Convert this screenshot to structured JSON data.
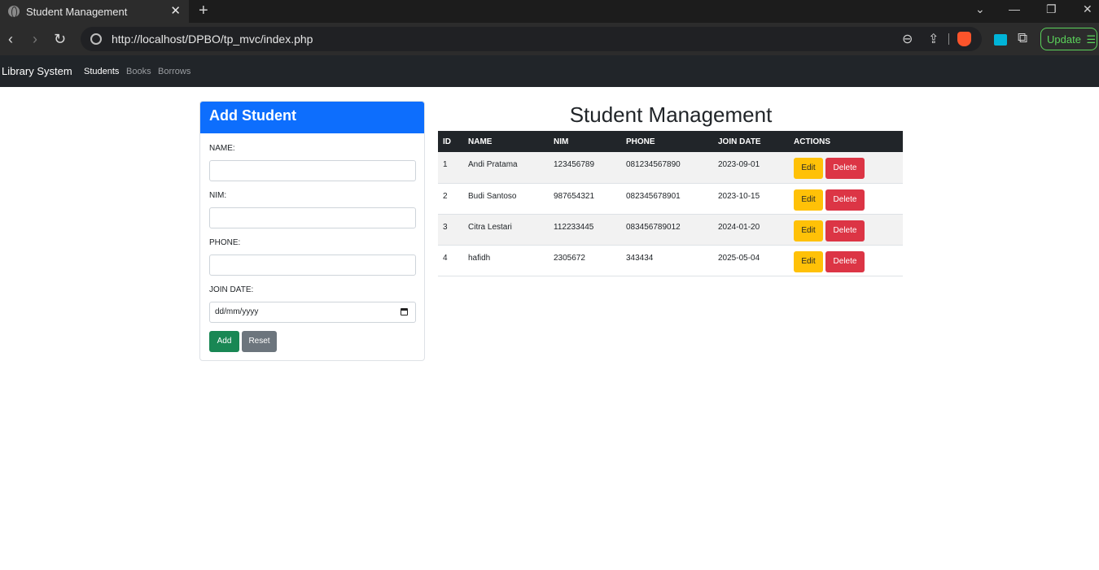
{
  "browser": {
    "tab_title": "Student Management",
    "url": "http://localhost/DPBO/tp_mvc/index.php",
    "update_label": "Update",
    "colors": {
      "accent_update": "#5bd35b",
      "brave": "#fb542b"
    }
  },
  "navbar": {
    "brand": "Library System",
    "links": [
      "Students",
      "Books",
      "Borrows"
    ],
    "active_link": "Students"
  },
  "form": {
    "title": "Add Student",
    "fields": {
      "name_label": "NAME:",
      "nim_label": "NIM:",
      "phone_label": "PHONE:",
      "join_date_label": "JOIN DATE:",
      "join_date_placeholder": "dd/mm/yyyy"
    },
    "add_label": "Add",
    "reset_label": "Reset",
    "colors": {
      "header": "#0d6efd",
      "add": "#198754",
      "reset": "#6c757d"
    }
  },
  "main": {
    "title": "Student Management",
    "table": {
      "headers": [
        "ID",
        "NAME",
        "NIM",
        "PHONE",
        "JOIN DATE",
        "ACTIONS"
      ],
      "rows": [
        [
          "1",
          "Andi Pratama",
          "123456789",
          "081234567890",
          "2023-09-01"
        ],
        [
          "2",
          "Budi Santoso",
          "987654321",
          "082345678901",
          "2023-10-15"
        ],
        [
          "3",
          "Citra Lestari",
          "112233445",
          "083456789012",
          "2024-01-20"
        ],
        [
          "4",
          "hafidh",
          "2305672",
          "343434",
          "2025-05-04"
        ]
      ],
      "edit_label": "Edit",
      "delete_label": "Delete"
    },
    "colors": {
      "edit": "#ffc107",
      "delete": "#dc3545",
      "header_bg": "#212529"
    }
  }
}
